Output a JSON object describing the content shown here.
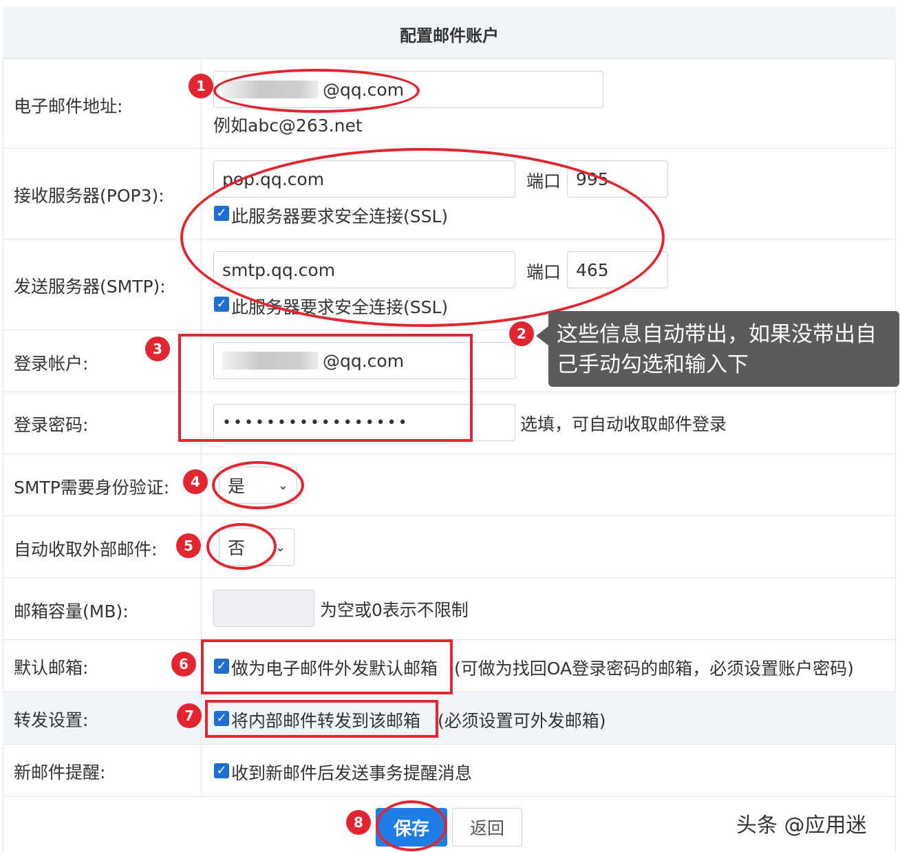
{
  "title": "配置邮件账户",
  "email": {
    "label": "电子邮件地址:",
    "domain": "@qq.com",
    "hint": "例如abc@263.net"
  },
  "pop3": {
    "label": "接收服务器(POP3):",
    "server": "pop.qq.com",
    "port_label": "端口",
    "port": "995",
    "ssl_label": "此服务器要求安全连接(SSL)"
  },
  "smtp": {
    "label": "发送服务器(SMTP):",
    "server": "smtp.qq.com",
    "port_label": "端口",
    "port": "465",
    "ssl_label": "此服务器要求安全连接(SSL)"
  },
  "login_account": {
    "label": "登录帐户:",
    "domain": "@qq.com"
  },
  "login_password": {
    "label": "登录密码:",
    "value": "•••••••••••••••••",
    "hint": "选填，可自动收取邮件登录"
  },
  "smtp_auth": {
    "label": "SMTP需要身份验证:",
    "value": "是"
  },
  "auto_fetch": {
    "label": "自动收取外部邮件:",
    "value": "否"
  },
  "capacity": {
    "label": "邮箱容量(MB):",
    "hint": "为空或0表示不限制"
  },
  "default_mailbox": {
    "label": "默认邮箱:",
    "check_label": "做为电子邮件外发默认邮箱",
    "note": "(可做为找回OA登录密码的邮箱，必须设置账户密码)"
  },
  "forward": {
    "label": "转发设置:",
    "check_label": "将内部邮件转发到该邮箱",
    "note": "(必须设置可外发邮箱)"
  },
  "new_mail": {
    "label": "新邮件提醒:",
    "check_label": "收到新邮件后发送事务提醒消息"
  },
  "buttons": {
    "save": "保存",
    "back": "返回"
  },
  "tooltip": "这些信息自动带出，如果没带出自己手动勾选和输入下",
  "badges": [
    "1",
    "2",
    "3",
    "4",
    "5",
    "6",
    "7",
    "8"
  ],
  "watermark": "头条 @应用迷",
  "colors": {
    "accent": "#1e7de6",
    "annotation": "#e2252e",
    "header_bg": "#f1f5fa",
    "highlight_row": "#f1f5fa"
  }
}
